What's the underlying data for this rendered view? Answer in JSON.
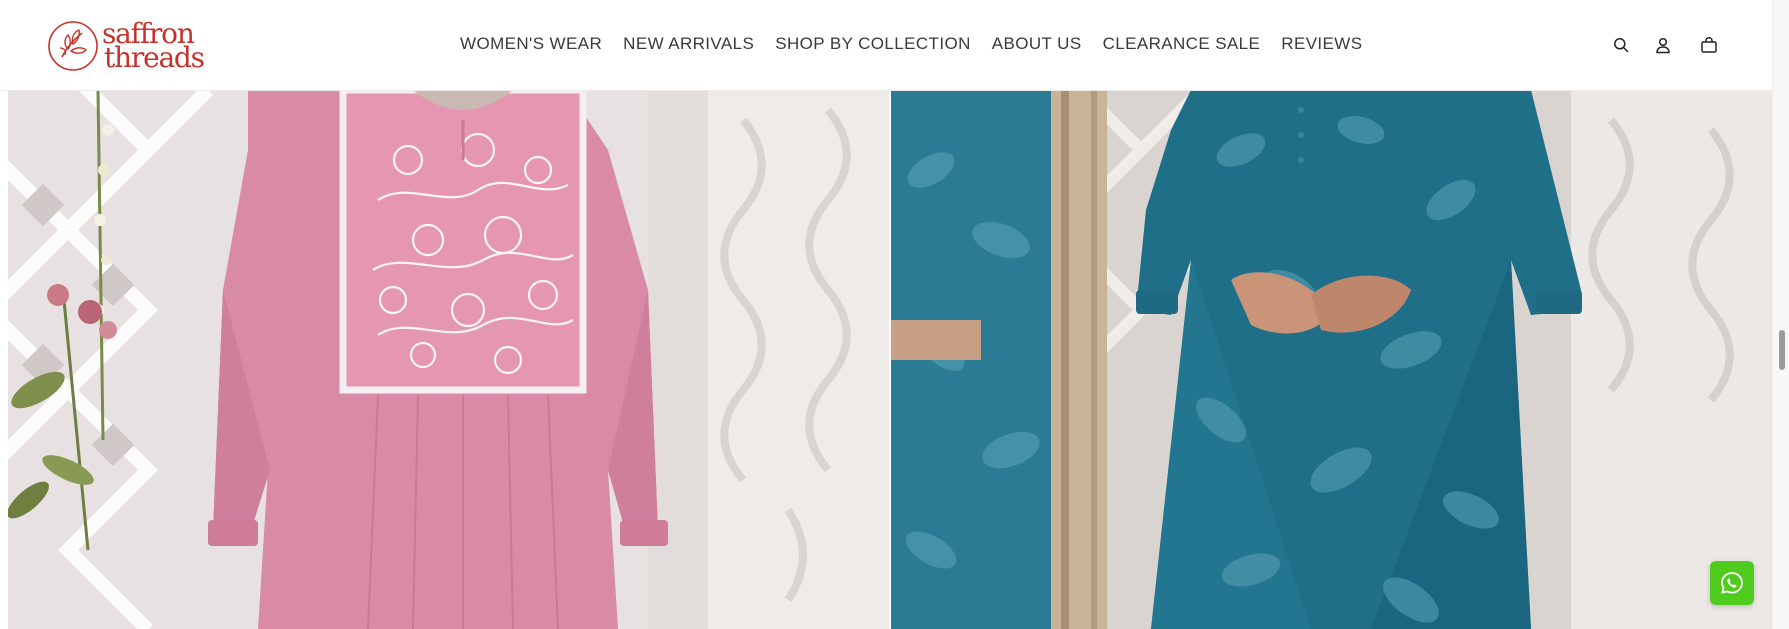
{
  "brand": {
    "line1": "saffron",
    "line2": "threads",
    "color": "#c8312a"
  },
  "nav": {
    "items": [
      {
        "label": "WOMEN'S WEAR"
      },
      {
        "label": "NEW ARRIVALS"
      },
      {
        "label": "SHOP BY COLLECTION"
      },
      {
        "label": "ABOUT US"
      },
      {
        "label": "CLEARANCE SALE"
      },
      {
        "label": "REVIEWS"
      }
    ]
  },
  "header_icons": [
    "search-icon",
    "account-icon",
    "cart-icon"
  ],
  "hero": {
    "left_panel": {
      "subject": "pink-embroidered-kurta",
      "dress_color": "#d98aa6"
    },
    "right_panel": {
      "subject": "teal-floral-dress",
      "dress_color": "#1f6f88"
    }
  },
  "floating": {
    "whatsapp_color": "#4fcb1e",
    "icon": "whatsapp-icon"
  },
  "scrollbar": {
    "position_fraction": 0.56
  }
}
